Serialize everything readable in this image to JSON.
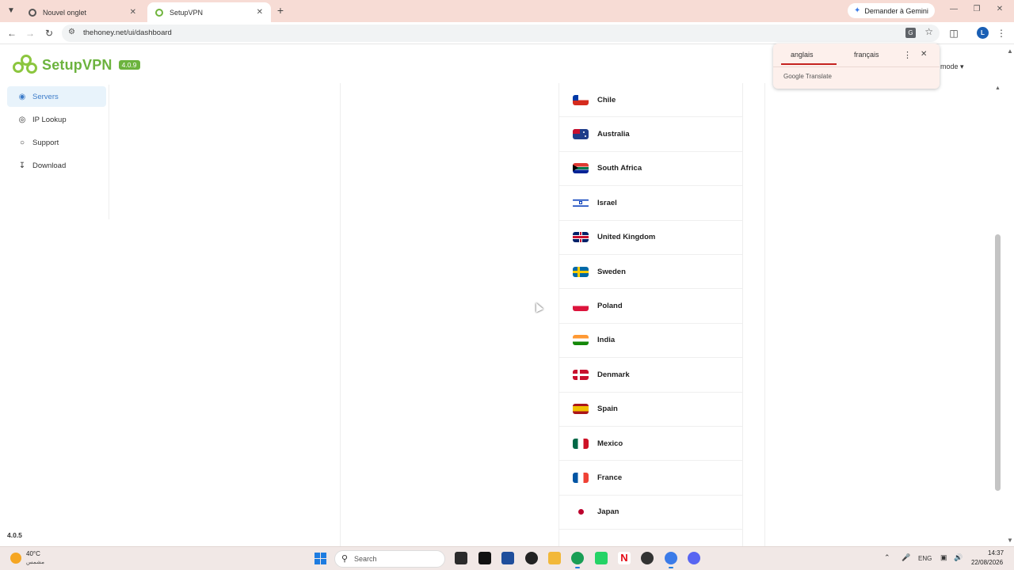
{
  "browser": {
    "tabs": [
      {
        "title": "Nouvel onglet",
        "active": false
      },
      {
        "title": "SetupVPN",
        "active": true
      }
    ],
    "gemini_label": "Demander à Gemini",
    "url": "thehoney.net/ui/dashboard",
    "profile_initial": "L"
  },
  "app": {
    "brand": "SetupVPN",
    "version_badge": "4.0.9",
    "footer_version": "4.0.5",
    "nav": [
      {
        "label": "Servers",
        "icon": "globe-icon",
        "active": true
      },
      {
        "label": "IP Lookup",
        "icon": "location-pin-icon",
        "active": false
      },
      {
        "label": "Support",
        "icon": "support-icon",
        "active": false
      },
      {
        "label": "Download",
        "icon": "download-icon",
        "active": false
      }
    ],
    "mode_label": "mode",
    "countries": [
      {
        "name": "Chile",
        "flag": "cl"
      },
      {
        "name": "Australia",
        "flag": "au"
      },
      {
        "name": "South Africa",
        "flag": "za"
      },
      {
        "name": "Israel",
        "flag": "il"
      },
      {
        "name": "United Kingdom",
        "flag": "gb"
      },
      {
        "name": "Sweden",
        "flag": "se"
      },
      {
        "name": "Poland",
        "flag": "pl"
      },
      {
        "name": "India",
        "flag": "in"
      },
      {
        "name": "Denmark",
        "flag": "dk"
      },
      {
        "name": "Spain",
        "flag": "es"
      },
      {
        "name": "Mexico",
        "flag": "mx"
      },
      {
        "name": "France",
        "flag": "fr"
      },
      {
        "name": "Japan",
        "flag": "jp"
      }
    ]
  },
  "translate_popup": {
    "source_lang": "anglais",
    "target_lang": "français",
    "footer": "Google Translate"
  },
  "taskbar": {
    "weather_temp": "40°C",
    "weather_condition": "مشمس",
    "search_placeholder": "Search",
    "language": "ENG",
    "time": "14:37",
    "date": "22/08/2026"
  },
  "colors": {
    "brand_green": "#6cb33e",
    "nav_active_bg": "#e8f3fb",
    "nav_active_text": "#3d7cc9",
    "tabstrip": "#f7dcd5"
  }
}
